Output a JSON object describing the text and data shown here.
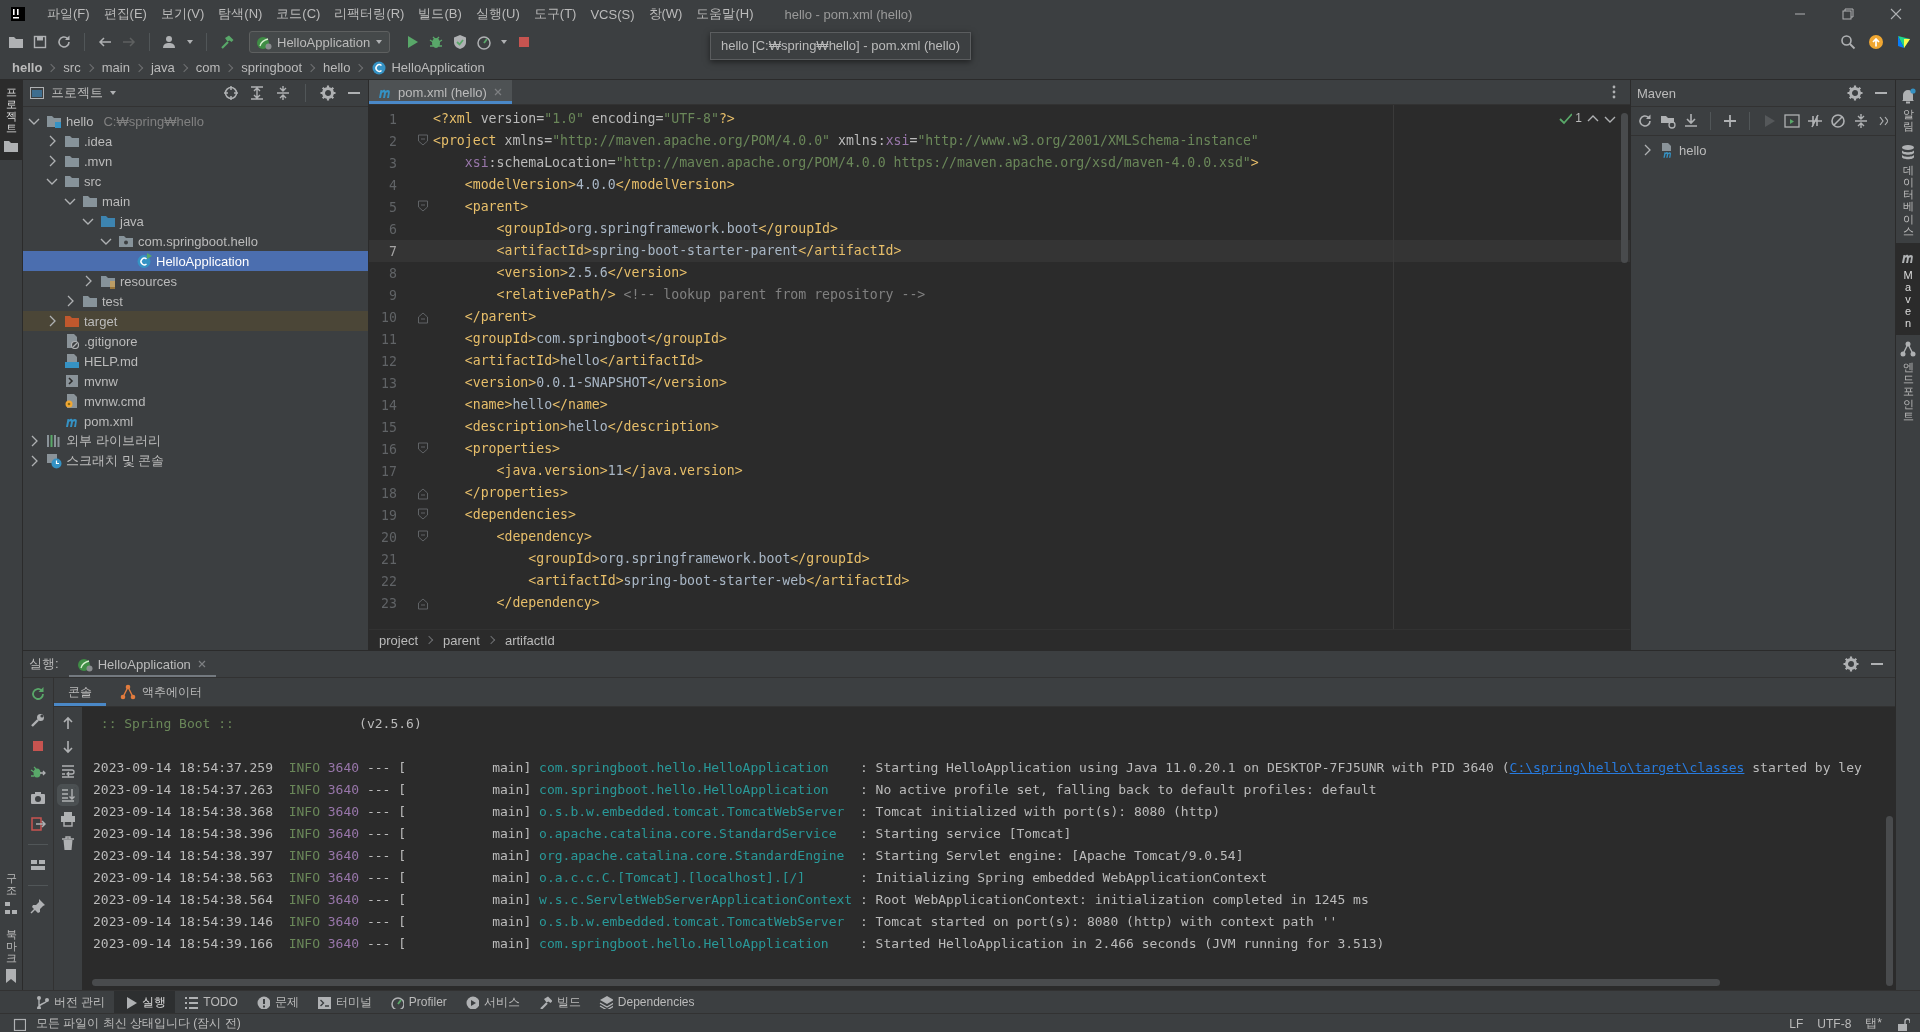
{
  "title_bar": {
    "menus": [
      "파일(F)",
      "편집(E)",
      "보기(V)",
      "탐색(N)",
      "코드(C)",
      "리팩터링(R)",
      "빌드(B)",
      "실행(U)",
      "도구(T)",
      "VCS(S)",
      "창(W)",
      "도움말(H)"
    ],
    "title": "hello - pom.xml (hello)"
  },
  "toolbar": {
    "run_configuration": "HelloApplication"
  },
  "tooltip": "hello [C:₩spring₩hello] - pom.xml (hello)",
  "navigation_bar": [
    "hello",
    "src",
    "main",
    "java",
    "com",
    "springboot",
    "hello",
    "HelloApplication"
  ],
  "left_stripe": {
    "top": [
      {
        "label": "프로젝트",
        "selected": true
      }
    ],
    "bottom": [
      {
        "label": "구조",
        "selected": false
      },
      {
        "label": "북마크",
        "selected": false
      }
    ]
  },
  "project_panel": {
    "title": "프로젝트",
    "tree": [
      {
        "label": "hello",
        "path": "C:₩spring₩hello",
        "kind": "module",
        "expanded": true,
        "selected": false,
        "children": [
          {
            "label": ".idea",
            "kind": "folder",
            "expanded": false,
            "selected": false
          },
          {
            "label": ".mvn",
            "kind": "folder",
            "expanded": false,
            "selected": false
          },
          {
            "label": "src",
            "kind": "folder",
            "expanded": true,
            "selected": false,
            "children": [
              {
                "label": "main",
                "kind": "folder",
                "expanded": true,
                "selected": false,
                "children": [
                  {
                    "label": "java",
                    "kind": "source",
                    "expanded": true,
                    "selected": false,
                    "children": [
                      {
                        "label": "com.springboot.hello",
                        "kind": "package",
                        "expanded": true,
                        "selected": false,
                        "children": [
                          {
                            "label": "HelloApplication",
                            "kind": "class",
                            "selected": true
                          }
                        ]
                      }
                    ]
                  },
                  {
                    "label": "resources",
                    "kind": "resources",
                    "expanded": false,
                    "selected": false
                  }
                ]
              },
              {
                "label": "test",
                "kind": "folder",
                "expanded": false,
                "selected": false
              }
            ]
          },
          {
            "label": "target",
            "kind": "excluded",
            "expanded": false,
            "selected": false
          },
          {
            "label": ".gitignore",
            "kind": "ignore",
            "selected": false
          },
          {
            "label": "HELP.md",
            "kind": "markdown",
            "selected": false
          },
          {
            "label": "mvnw",
            "kind": "shell",
            "selected": false
          },
          {
            "label": "mvnw.cmd",
            "kind": "cmd",
            "selected": false
          },
          {
            "label": "pom.xml",
            "kind": "maven",
            "selected": false
          }
        ]
      },
      {
        "label": "외부 라이브러리",
        "kind": "libraries",
        "expanded": false,
        "selected": false
      },
      {
        "label": "스크래치 및 콘솔",
        "kind": "scratches",
        "expanded": false,
        "selected": false
      }
    ]
  },
  "editor": {
    "tabs": [
      {
        "label": "pom.xml (hello)",
        "selected": true
      }
    ],
    "inspection_count": "1",
    "lines": [
      {
        "number": "1",
        "code": "<?xml version=\"1.0\" encoding=\"UTF-8\"?>",
        "current": false,
        "kind": "plain"
      },
      {
        "number": "2",
        "code": "<project xmlns=\"http://maven.apache.org/POM/4.0.0\" xmlns:xsi=\"http://www.w3.org/2001/XMLSchema-instance\"",
        "current": false,
        "kind": "foldstart"
      },
      {
        "number": "3",
        "code": "    xsi:schemaLocation=\"http://maven.apache.org/POM/4.0.0 https://maven.apache.org/xsd/maven-4.0.0.xsd\">",
        "current": false,
        "kind": "plain"
      },
      {
        "number": "4",
        "code": "    <modelVersion>4.0.0</modelVersion>",
        "current": false,
        "kind": "plain"
      },
      {
        "number": "5",
        "code": "    <parent>",
        "current": false,
        "kind": "foldstart"
      },
      {
        "number": "6",
        "code": "        <groupId>org.springframework.boot</groupId>",
        "current": false,
        "kind": "plain"
      },
      {
        "number": "7",
        "code": "        <artifactId>spring-boot-starter-parent</artifactId>",
        "current": true,
        "kind": "plain"
      },
      {
        "number": "8",
        "code": "        <version>2.5.6</version>",
        "current": false,
        "kind": "plain"
      },
      {
        "number": "9",
        "code": "        <relativePath/> <!-- lookup parent from repository -->",
        "current": false,
        "kind": "plain"
      },
      {
        "number": "10",
        "code": "    </parent>",
        "current": false,
        "kind": "foldend"
      },
      {
        "number": "11",
        "code": "    <groupId>com.springboot</groupId>",
        "current": false,
        "kind": "plain"
      },
      {
        "number": "12",
        "code": "    <artifactId>hello</artifactId>",
        "current": false,
        "kind": "plain"
      },
      {
        "number": "13",
        "code": "    <version>0.0.1-SNAPSHOT</version>",
        "current": false,
        "kind": "plain"
      },
      {
        "number": "14",
        "code": "    <name>hello</name>",
        "current": false,
        "kind": "plain"
      },
      {
        "number": "15",
        "code": "    <description>hello</description>",
        "current": false,
        "kind": "plain"
      },
      {
        "number": "16",
        "code": "    <properties>",
        "current": false,
        "kind": "foldstart"
      },
      {
        "number": "17",
        "code": "        <java.version>11</java.version>",
        "current": false,
        "kind": "plain"
      },
      {
        "number": "18",
        "code": "    </properties>",
        "current": false,
        "kind": "foldend"
      },
      {
        "number": "19",
        "code": "    <dependencies>",
        "current": false,
        "kind": "foldstart"
      },
      {
        "number": "20",
        "code": "        <dependency>",
        "current": false,
        "kind": "foldstart"
      },
      {
        "number": "21",
        "code": "            <groupId>org.springframework.boot</groupId>",
        "current": false,
        "kind": "plain"
      },
      {
        "number": "22",
        "code": "            <artifactId>spring-boot-starter-web</artifactId>",
        "current": false,
        "kind": "plain"
      },
      {
        "number": "23",
        "code": "        </dependency>",
        "current": false,
        "kind": "foldend"
      }
    ],
    "breadcrumbs": [
      "project",
      "parent",
      "artifactId"
    ]
  },
  "maven_panel": {
    "title": "Maven",
    "tree": [
      {
        "label": "hello",
        "expanded": false
      }
    ]
  },
  "right_stripe": [
    {
      "label": "알림",
      "selected": false
    },
    {
      "label": "데이터베이스",
      "selected": false
    },
    {
      "label": "Maven",
      "selected": true
    },
    {
      "label": "엔드포인트",
      "selected": false
    }
  ],
  "run_panel": {
    "title": "실행:",
    "tabs": [
      {
        "label": "HelloApplication",
        "selected": true
      }
    ],
    "subtabs": [
      {
        "label": "콘솔",
        "selected": true
      },
      {
        "label": "액추에이터",
        "selected": false
      }
    ],
    "console": {
      "banner": ":: Spring Boot ::",
      "version": "(v2.5.6)",
      "logs": [
        {
          "timestamp": "2023-09-14 18:54:37.259",
          "level": "INFO",
          "pid": "3640",
          "separator": "--- [",
          "thread": "main]",
          "logger": "com.springboot.hello.HelloApplication",
          "message": ": Starting HelloApplication using Java 11.0.20.1 on DESKTOP-7FJ5UNR with PID 3640 (",
          "link": "C:\\spring\\hello\\target\\classes",
          "message_end": " started by ley"
        },
        {
          "timestamp": "2023-09-14 18:54:37.263",
          "level": "INFO",
          "pid": "3640",
          "separator": "--- [",
          "thread": "main]",
          "logger": "com.springboot.hello.HelloApplication",
          "message": ": No active profile set, falling back to default profiles: default"
        },
        {
          "timestamp": "2023-09-14 18:54:38.368",
          "level": "INFO",
          "pid": "3640",
          "separator": "--- [",
          "thread": "main]",
          "logger": "o.s.b.w.embedded.tomcat.TomcatWebServer",
          "message": ": Tomcat initialized with port(s): 8080 (http)"
        },
        {
          "timestamp": "2023-09-14 18:54:38.396",
          "level": "INFO",
          "pid": "3640",
          "separator": "--- [",
          "thread": "main]",
          "logger": "o.apache.catalina.core.StandardService",
          "message": ": Starting service [Tomcat]"
        },
        {
          "timestamp": "2023-09-14 18:54:38.397",
          "level": "INFO",
          "pid": "3640",
          "separator": "--- [",
          "thread": "main]",
          "logger": "org.apache.catalina.core.StandardEngine",
          "message": ": Starting Servlet engine: [Apache Tomcat/9.0.54]"
        },
        {
          "timestamp": "2023-09-14 18:54:38.563",
          "level": "INFO",
          "pid": "3640",
          "separator": "--- [",
          "thread": "main]",
          "logger": "o.a.c.c.C.[Tomcat].[localhost].[/]",
          "message": ": Initializing Spring embedded WebApplicationContext"
        },
        {
          "timestamp": "2023-09-14 18:54:38.564",
          "level": "INFO",
          "pid": "3640",
          "separator": "--- [",
          "thread": "main]",
          "logger": "w.s.c.ServletWebServerApplicationContext",
          "message": ": Root WebApplicationContext: initialization completed in 1245 ms"
        },
        {
          "timestamp": "2023-09-14 18:54:39.146",
          "level": "INFO",
          "pid": "3640",
          "separator": "--- [",
          "thread": "main]",
          "logger": "o.s.b.w.embedded.tomcat.TomcatWebServer",
          "message": ": Tomcat started on port(s): 8080 (http) with context path ''"
        },
        {
          "timestamp": "2023-09-14 18:54:39.166",
          "level": "INFO",
          "pid": "3640",
          "separator": "--- [",
          "thread": "main]",
          "logger": "com.springboot.hello.HelloApplication",
          "message": ": Started HelloApplication in 2.466 seconds (JVM running for 3.513)"
        }
      ]
    }
  },
  "tool_window_bar": [
    {
      "label": "버전 관리",
      "selected": false
    },
    {
      "label": "실행",
      "selected": true
    },
    {
      "label": "TODO",
      "selected": false
    },
    {
      "label": "문제",
      "selected": false
    },
    {
      "label": "터미널",
      "selected": false
    },
    {
      "label": "Profiler",
      "selected": false
    },
    {
      "label": "서비스",
      "selected": false
    },
    {
      "label": "빌드",
      "selected": false
    },
    {
      "label": "Dependencies",
      "selected": false
    }
  ],
  "status_bar": {
    "message": "모든 파일이 최신 상태입니다 (잠시 전)",
    "indicators": [
      "LF",
      "UTF-8",
      "탭*"
    ]
  }
}
